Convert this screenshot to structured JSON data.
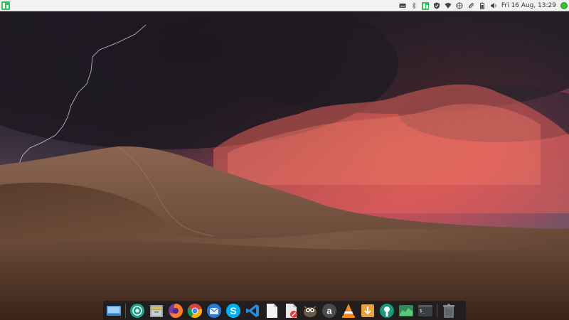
{
  "top_panel": {
    "clock": "Fri 16 Aug, 13:29",
    "tray_icons": [
      "keyboard-icon",
      "bluetooth-icon",
      "manjaro-settings-icon",
      "shield-icon",
      "wifi-icon",
      "network-icon",
      "attachment-icon",
      "battery-icon",
      "volume-icon",
      "clock",
      "update-icon"
    ]
  },
  "dock": {
    "items": [
      {
        "name": "desktop-switcher"
      },
      {
        "name": "screenshot-tool"
      },
      {
        "name": "file-manager"
      },
      {
        "name": "firefox"
      },
      {
        "name": "chrome"
      },
      {
        "name": "thunderbird"
      },
      {
        "name": "skype"
      },
      {
        "name": "vscode"
      },
      {
        "name": "text-editor"
      },
      {
        "name": "document-viewer"
      },
      {
        "name": "gimp"
      },
      {
        "name": "amazon"
      },
      {
        "name": "vlc"
      },
      {
        "name": "downloader"
      },
      {
        "name": "settings-manager"
      },
      {
        "name": "system-monitor"
      },
      {
        "name": "terminal"
      },
      {
        "name": "trash"
      }
    ]
  },
  "colors": {
    "panel_bg": "#f2f2f2",
    "accent": "#35bf5c",
    "dock_bg": "#1c1c1e"
  }
}
